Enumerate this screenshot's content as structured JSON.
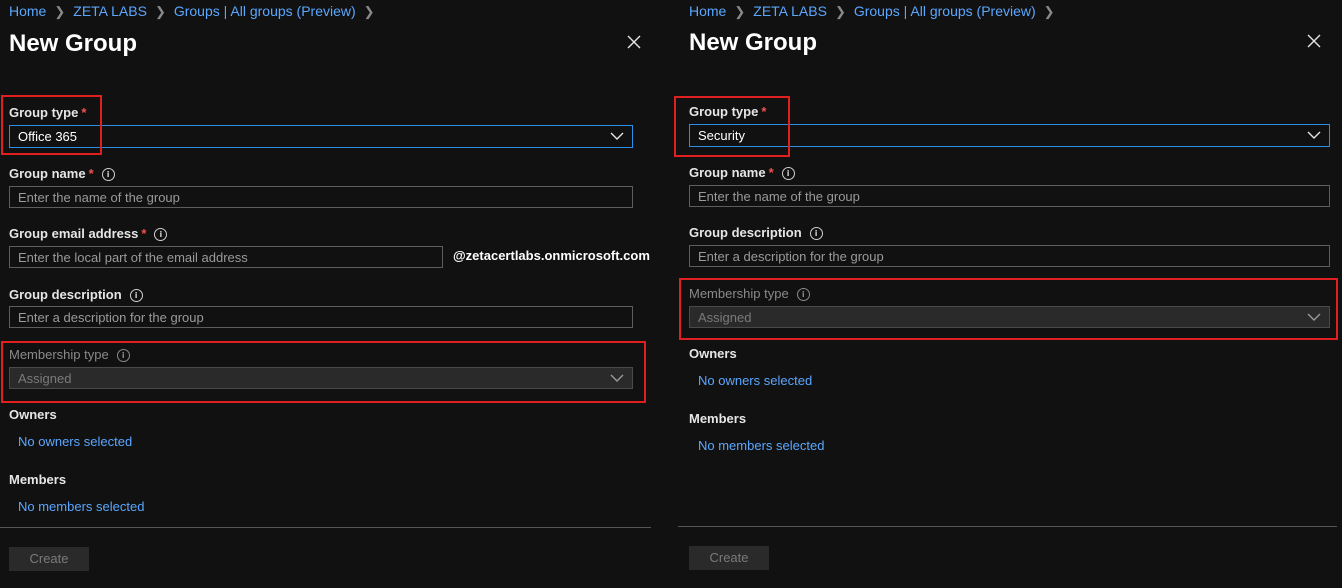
{
  "left": {
    "breadcrumb": [
      "Home",
      "ZETA LABS",
      "Groups | All groups (Preview)"
    ],
    "title": "New Group",
    "group_type": {
      "label": "Group type",
      "required": "*",
      "value": "Office 365"
    },
    "group_name": {
      "label": "Group name",
      "required": "*",
      "placeholder": "Enter the name of the group"
    },
    "group_email": {
      "label": "Group email address",
      "required": "*",
      "placeholder": "Enter the local part of the email address",
      "domain": "@zetacertlabs.onmicrosoft.com"
    },
    "group_description": {
      "label": "Group description",
      "placeholder": "Enter a description for the group"
    },
    "membership_type": {
      "label": "Membership type",
      "value": "Assigned"
    },
    "owners": {
      "label": "Owners",
      "link": "No owners selected"
    },
    "members": {
      "label": "Members",
      "link": "No members selected"
    },
    "create_label": "Create"
  },
  "right": {
    "breadcrumb": [
      "Home",
      "ZETA LABS",
      "Groups | All groups (Preview)"
    ],
    "title": "New Group",
    "group_type": {
      "label": "Group type",
      "required": "*",
      "value": "Security"
    },
    "group_name": {
      "label": "Group name",
      "required": "*",
      "placeholder": "Enter the name of the group"
    },
    "group_description": {
      "label": "Group description",
      "placeholder": "Enter a description for the group"
    },
    "membership_type": {
      "label": "Membership type",
      "value": "Assigned"
    },
    "owners": {
      "label": "Owners",
      "link": "No owners selected"
    },
    "members": {
      "label": "Members",
      "link": "No members selected"
    },
    "create_label": "Create"
  },
  "icons": {
    "close": "close-icon",
    "info": "info-icon",
    "chevron": "chevron-down-icon",
    "breadcrumb_separator": "chevron-right-icon"
  },
  "colors": {
    "link": "#5aa7ff",
    "required": "#f25050",
    "highlight": "#e02020",
    "focus_border": "#2c8fe6",
    "background": "#111111"
  }
}
